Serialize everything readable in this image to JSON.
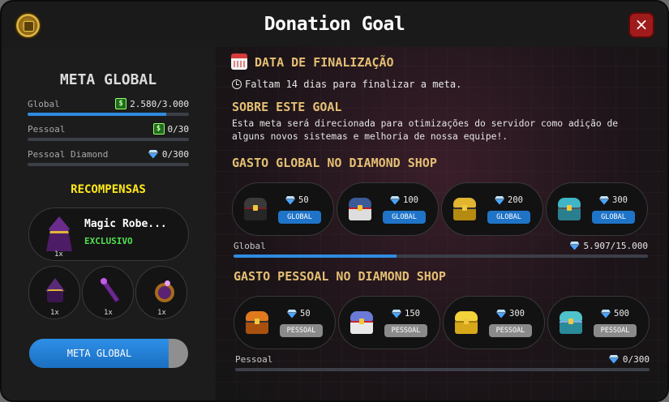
{
  "header": {
    "title": "Donation Goal",
    "close_label": "×"
  },
  "left": {
    "meta_title": "META GLOBAL",
    "stats": [
      {
        "label": "Global",
        "value": "2.580/3.000",
        "icon": "cash-icon",
        "progress": 0.86
      },
      {
        "label": "Pessoal",
        "value": "0/30",
        "icon": "cash-icon",
        "progress": 0.0
      },
      {
        "label": "Pessoal Diamond",
        "value": "0/300",
        "icon": "diamond-icon",
        "progress": 0.0
      }
    ],
    "rewards_title": "RECOMPENSAS",
    "main_reward": {
      "name": "Magic Robe...",
      "tag": "EXCLUSIVO",
      "qty": "1x"
    },
    "small_rewards": [
      {
        "name": "hat",
        "qty": "1x"
      },
      {
        "name": "staff",
        "qty": "1x"
      },
      {
        "name": "ring",
        "qty": "1x"
      }
    ],
    "button_label": "META GLOBAL",
    "button_progress": 0.88
  },
  "right": {
    "end_title": "DATA DE FINALIZAÇÃO",
    "remaining_text": "Faltam 14 dias para finalizar a meta.",
    "about_title": "SOBRE ESTE GOAL",
    "about_text": "Esta meta será direcionada para otimizações do servidor como adição de alguns novos sistemas e melhoria de nossa equipe!.",
    "global_title": "GASTO GLOBAL NO DIAMOND SHOP",
    "global_tiers": [
      {
        "price": "50",
        "badge": "GLOBAL",
        "chest": "black-chest-icon"
      },
      {
        "price": "100",
        "badge": "GLOBAL",
        "chest": "blue-chest-icon"
      },
      {
        "price": "200",
        "badge": "GLOBAL",
        "chest": "gold-chest-icon"
      },
      {
        "price": "300",
        "badge": "GLOBAL",
        "chest": "cyan-chest-icon"
      }
    ],
    "global_progress": {
      "label": "Global",
      "value": "5.907/15.000",
      "fraction": 0.3938
    },
    "personal_title": "GASTO PESSOAL NO DIAMOND SHOP",
    "personal_tiers": [
      {
        "price": "50",
        "badge": "PESSOAL",
        "chest": "orange-chest-icon"
      },
      {
        "price": "150",
        "badge": "PESSOAL",
        "chest": "pink-chest-icon"
      },
      {
        "price": "300",
        "badge": "PESSOAL",
        "chest": "yellow-chest-icon"
      },
      {
        "price": "500",
        "badge": "PESSOAL",
        "chest": "teal-chest-icon"
      }
    ],
    "personal_progress": {
      "label": "Pessoal",
      "value": "0/300",
      "fraction": 0.0
    }
  },
  "colors": {
    "accent_blue": "#2f8be0",
    "gold_heading": "#e4bf74",
    "yellow_heading": "#ffe81a",
    "exclusive_green": "#52e052",
    "close_red": "#a01b1b"
  }
}
